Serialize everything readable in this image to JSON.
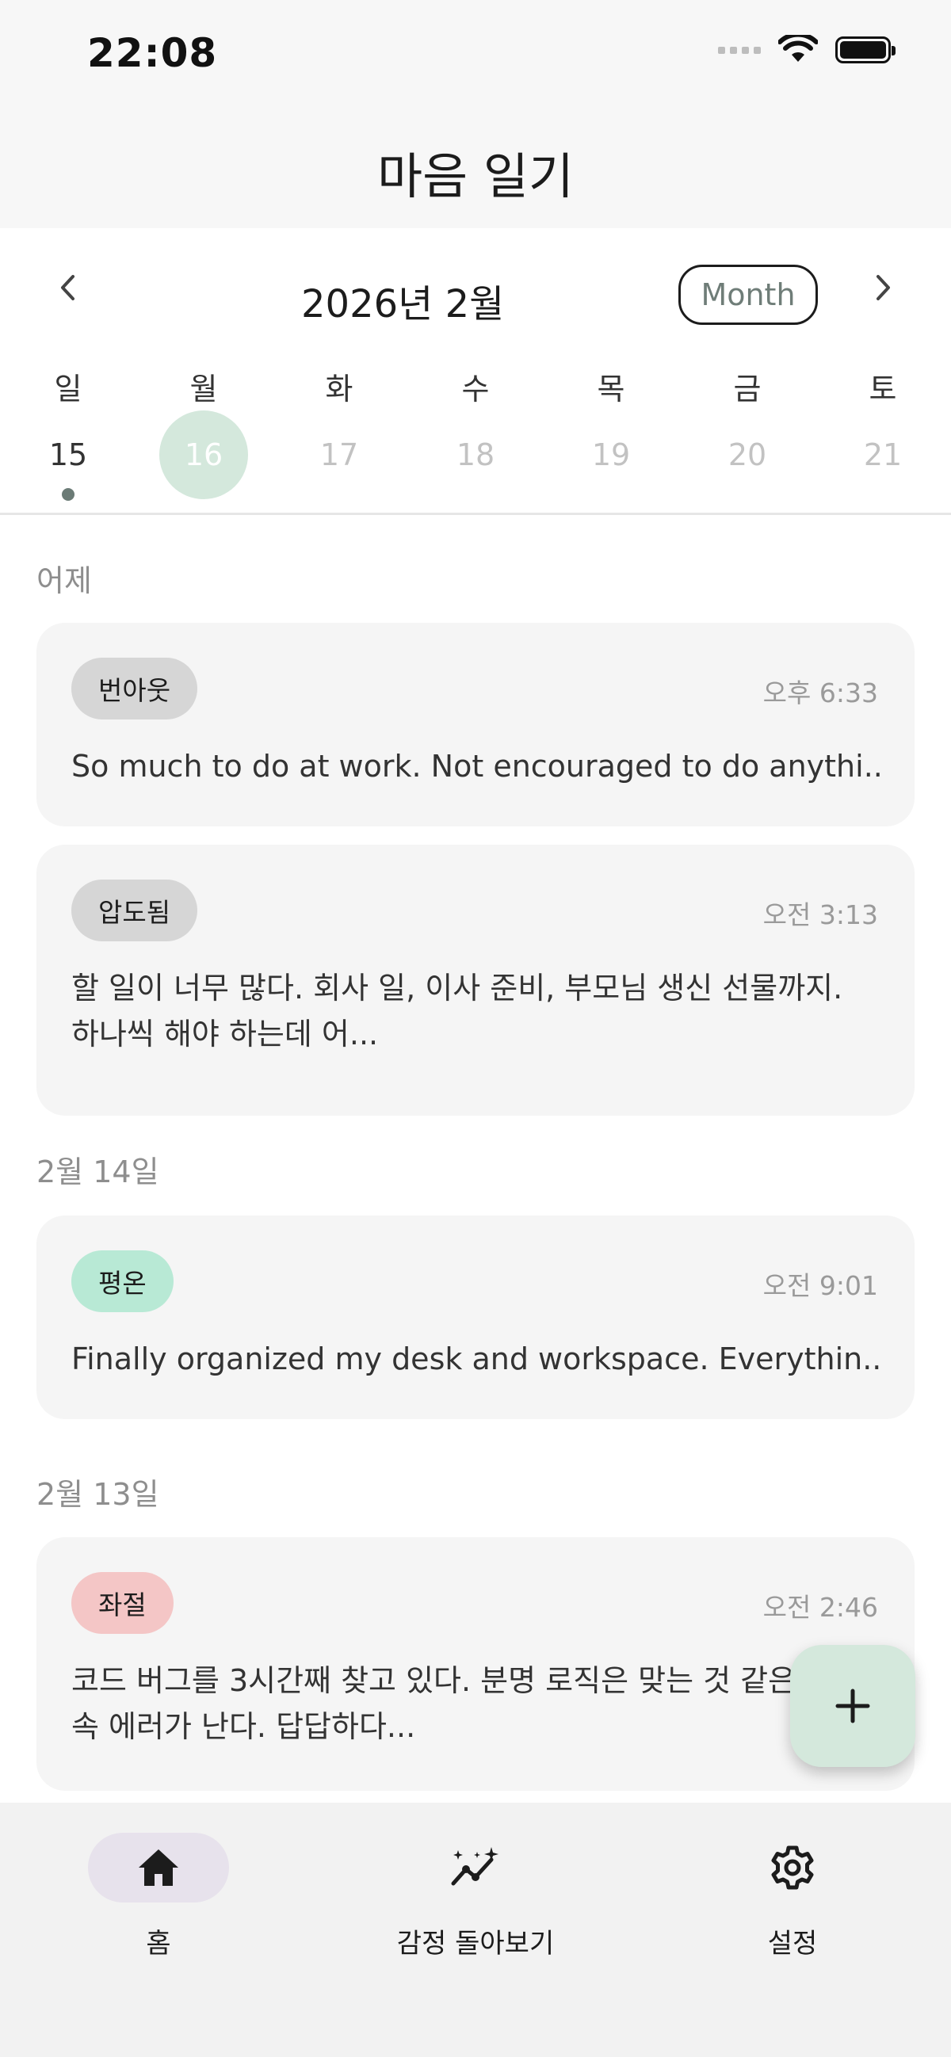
{
  "status_bar": {
    "time": "22:08"
  },
  "header": {
    "title": "마음 일기"
  },
  "calendar": {
    "month_label": "2026년 2월",
    "view_button": "Month",
    "weekdays": [
      "일",
      "월",
      "화",
      "수",
      "목",
      "금",
      "토"
    ],
    "dates": [
      "15",
      "16",
      "17",
      "18",
      "19",
      "20",
      "21"
    ]
  },
  "sections": [
    {
      "label": "어제",
      "entries": [
        {
          "tag": "번아웃",
          "tag_color": "#d6d6d6",
          "time": "오후 6:33",
          "text": "So much to do at work. Not encouraged to do anythi..."
        },
        {
          "tag": "압도됨",
          "tag_color": "#d6d6d6",
          "time": "오전 3:13",
          "text": "할 일이 너무 많다. 회사 일, 이사 준비, 부모님 생신 선물까지. 하나씩 해야 하는데 어..."
        }
      ]
    },
    {
      "label": "2월 14일",
      "entries": [
        {
          "tag": "평온",
          "tag_color": "#b8e9d5",
          "time": "오전 9:01",
          "text": "Finally organized my desk and workspace. Everythin..."
        }
      ]
    },
    {
      "label": "2월 13일",
      "entries": [
        {
          "tag": "좌절",
          "tag_color": "#f4c6c6",
          "time": "오전 2:46",
          "text": "코드 버그를 3시간째 찾고 있다. 분명 로직은 맞는 것 같은데 계속 에러가 난다. 답답하다..."
        }
      ]
    }
  ],
  "tab_bar": {
    "items": [
      {
        "label": "홈",
        "icon": "home-icon"
      },
      {
        "label": "감정 돌아보기",
        "icon": "trend-sparkle-icon"
      },
      {
        "label": "설정",
        "icon": "gear-icon"
      }
    ]
  }
}
